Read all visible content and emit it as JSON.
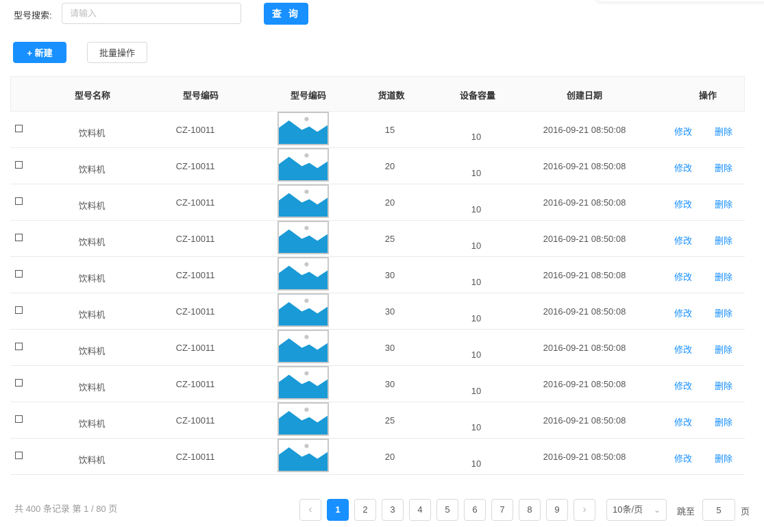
{
  "search": {
    "label": "型号搜索:",
    "placeholder": "请输入",
    "value": "",
    "button_label": "查 询"
  },
  "toolbar": {
    "new_label": "+ 新建",
    "batch_label": "批量操作"
  },
  "table": {
    "headers": [
      "型号名称",
      "型号编码",
      "型号编码",
      "货道数",
      "设备容量",
      "创建日期",
      "操作"
    ],
    "edit_label": "修改",
    "delete_label": "删除",
    "image_icon": "image-placeholder-icon",
    "rows": [
      {
        "name": "饮料机",
        "code": "CZ-10011",
        "slots": "15",
        "capacity": "10",
        "created": "2016-09-21  08:50:08"
      },
      {
        "name": "饮料机",
        "code": "CZ-10011",
        "slots": "20",
        "capacity": "10",
        "created": "2016-09-21  08:50:08"
      },
      {
        "name": "饮料机",
        "code": "CZ-10011",
        "slots": "20",
        "capacity": "10",
        "created": "2016-09-21  08:50:08"
      },
      {
        "name": "饮料机",
        "code": "CZ-10011",
        "slots": "25",
        "capacity": "10",
        "created": "2016-09-21  08:50:08"
      },
      {
        "name": "饮料机",
        "code": "CZ-10011",
        "slots": "30",
        "capacity": "10",
        "created": "2016-09-21  08:50:08"
      },
      {
        "name": "饮料机",
        "code": "CZ-10011",
        "slots": "30",
        "capacity": "10",
        "created": "2016-09-21  08:50:08"
      },
      {
        "name": "饮料机",
        "code": "CZ-10011",
        "slots": "30",
        "capacity": "10",
        "created": "2016-09-21  08:50:08"
      },
      {
        "name": "饮料机",
        "code": "CZ-10011",
        "slots": "30",
        "capacity": "10",
        "created": "2016-09-21  08:50:08"
      },
      {
        "name": "饮料机",
        "code": "CZ-10011",
        "slots": "25",
        "capacity": "10",
        "created": "2016-09-21  08:50:08"
      },
      {
        "name": "饮料机",
        "code": "CZ-10011",
        "slots": "20",
        "capacity": "10",
        "created": "2016-09-21  08:50:08"
      }
    ]
  },
  "pagination": {
    "summary": "共 400 条记录 第 1 / 80 页",
    "pages": [
      "1",
      "2",
      "3",
      "4",
      "5",
      "6",
      "7",
      "8",
      "9"
    ],
    "current": "1",
    "page_size_label": "10条/页",
    "jump_label": "跳至",
    "jump_value": "5",
    "jump_suffix": "页"
  },
  "colors": {
    "primary": "#1890ff",
    "image_fill": "#1a9ad6",
    "image_dot": "#c8c8c8"
  }
}
